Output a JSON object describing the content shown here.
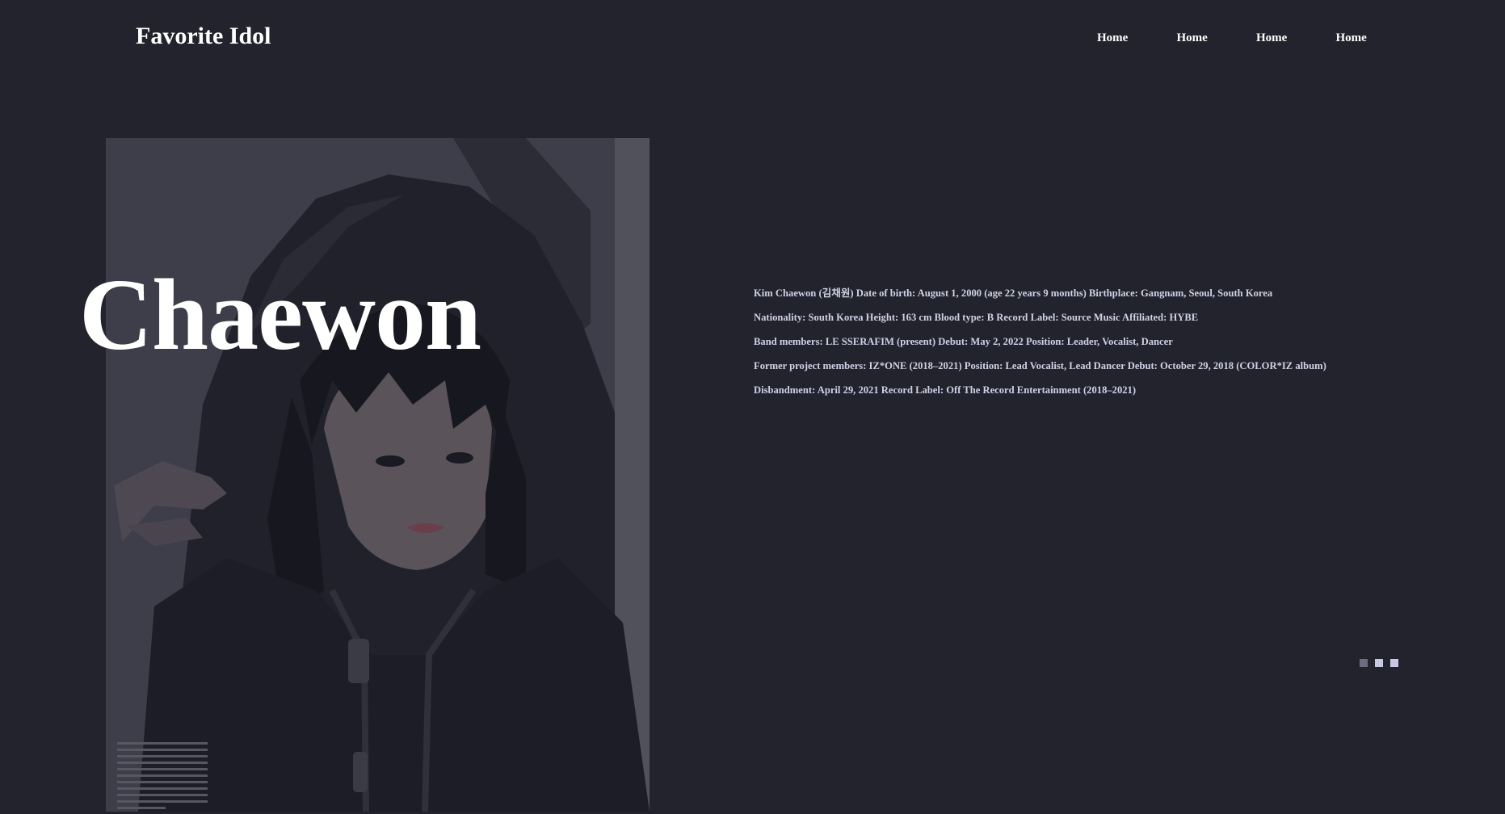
{
  "header": {
    "brand": "Favorite Idol",
    "nav": [
      "Home",
      "Home",
      "Home",
      "Home"
    ]
  },
  "hero": {
    "name": "Chaewon",
    "photo_icon": "portrait-photo"
  },
  "bio": {
    "lines": [
      "Kim Chaewon (김채원) Date of birth: August 1, 2000 (age 22 years 9 months) Birthplace: Gangnam, Seoul, South Korea",
      "Nationality: South Korea Height: 163 cm Blood type: B Record Label: Source Music Affiliated: HYBE",
      "Band members: LE SSERAFIM (present) Debut: May 2, 2022 Position: Leader, Vocalist, Dancer",
      "Former project members: IZ*ONE (2018–2021) Position: Lead Vocalist, Lead Dancer Debut: October 29, 2018 (COLOR*IZ album)",
      "Disbandment: April 29, 2021 Record Label: Off The Record Entertainment (2018–2021)"
    ]
  },
  "slider": {
    "count": 3,
    "active_index": 0
  },
  "colors": {
    "background": "#22232c",
    "text_primary": "#ffffff",
    "bio_text": "#cfd2e6",
    "dot_active": "#c9c8e3",
    "dot_inactive": "#6c6d80"
  }
}
